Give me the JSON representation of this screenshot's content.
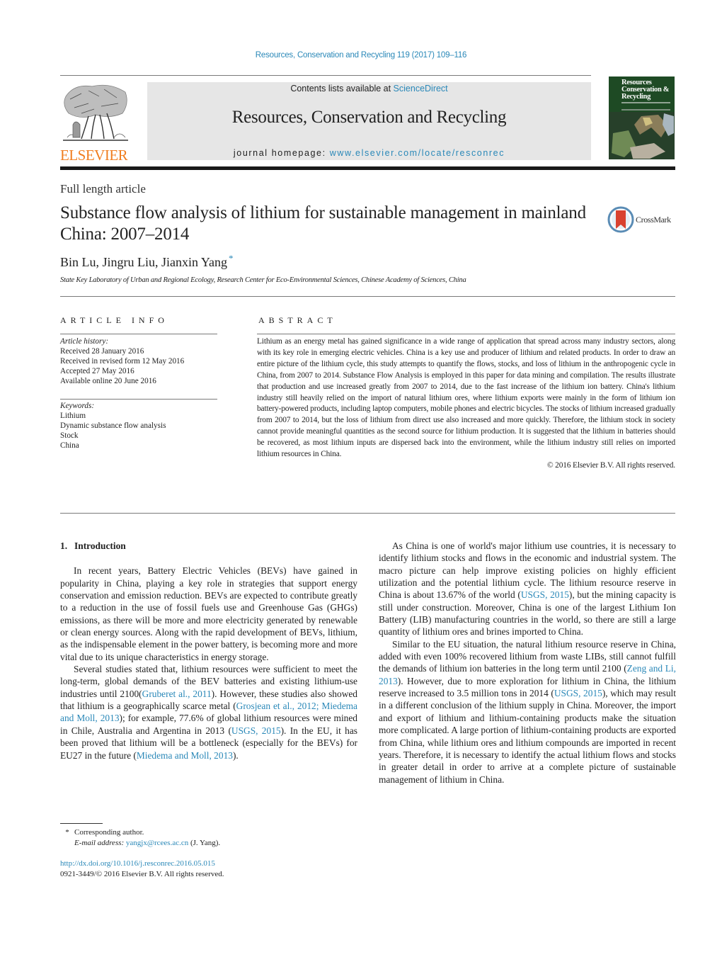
{
  "header": {
    "journal_reference": "Resources, Conservation and Recycling 119 (2017) 109–116",
    "contents_prefix": "Contents lists available at ",
    "contents_link": "ScienceDirect",
    "journal_title": "Resources, Conservation and Recycling",
    "homepage_prefix": "journal homepage: ",
    "homepage_link": "www.elsevier.com/locate/resconrec",
    "publisher_logo_text": "ELSEVIER",
    "cover_title": "Resources Conservation & Recycling",
    "crossmark_label": "CrossMark"
  },
  "article": {
    "type": "Full length article",
    "title": "Substance flow analysis of lithium for sustainable management in mainland China: 2007–2014",
    "authors": "Bin Lu, Jingru Liu, Jianxin Yang",
    "corresponding_marker": "*",
    "affiliation": "State Key Laboratory of Urban and Regional Ecology, Research Center for Eco-Environmental Sciences, Chinese Academy of Sciences, China"
  },
  "article_info": {
    "heading": "ARTICLE INFO",
    "history_label": "Article history:",
    "history": [
      "Received 28 January 2016",
      "Received in revised form 12 May 2016",
      "Accepted 27 May 2016",
      "Available online 20 June 2016"
    ],
    "keywords_label": "Keywords:",
    "keywords": [
      "Lithium",
      "Dynamic substance flow analysis",
      "Stock",
      "China"
    ]
  },
  "abstract": {
    "heading": "ABSTRACT",
    "text": "Lithium as an energy metal has gained significance in a wide range of application that spread across many industry sectors, along with its key role in emerging electric vehicles. China is a key use and producer of lithium and related products. In order to draw an entire picture of the lithium cycle, this study attempts to quantify the flows, stocks, and loss of lithium in the anthropogenic cycle in China, from 2007 to 2014. Substance Flow Analysis is employed in this paper for data mining and compilation. The results illustrate that production and use increased greatly from 2007 to 2014, due to the fast increase of the lithium ion battery. China's lithium industry still heavily relied on the import of natural lithium ores, where lithium exports were mainly in the form of lithium ion battery-powered products, including laptop computers, mobile phones and electric bicycles. The stocks of lithium increased gradually from 2007 to 2014, but the loss of lithium from direct use also increased and more quickly. Therefore, the lithium stock in society cannot provide meaningful quantities as the second source for lithium production. It is suggested that the lithium in batteries should be recovered, as most lithium inputs are dispersed back into the environment, while the lithium industry still relies on imported lithium resources in China.",
    "copyright": "© 2016 Elsevier B.V. All rights reserved."
  },
  "body": {
    "section_number": "1.",
    "section_title": "Introduction",
    "left_paragraphs": [
      {
        "segments": [
          {
            "text": "In recent years, Battery Electric Vehicles (BEVs) have gained in popularity in China, playing a key role in strategies that support energy conservation and emission reduction. BEVs are expected to contribute greatly to a reduction in the use of fossil fuels use and Greenhouse Gas (GHGs) emissions, as there will be more and more electricity generated by renewable or clean energy sources. Along with the rapid development of BEVs, lithium, as the indispensable element in the power battery, is becoming more and more vital due to its unique characteristics in energy storage."
          }
        ]
      },
      {
        "segments": [
          {
            "text": "Several studies stated that, lithium resources were sufficient to meet the long-term, global demands of the BEV batteries and existing lithium-use industries until 2100("
          },
          {
            "text": "Gruberet al., 2011",
            "link": true
          },
          {
            "text": "). However, these studies also showed that lithium is a geographically scarce metal ("
          },
          {
            "text": "Grosjean et al., 2012; Miedema and Moll, 2013",
            "link": true
          },
          {
            "text": "); for example, 77.6% of global lithium resources were mined in Chile, Australia and Argentina in 2013 ("
          },
          {
            "text": "USGS, 2015",
            "link": true
          },
          {
            "text": "). In the EU, it has been proved that lithium will be a bottleneck (especially for the BEVs) for EU27 in the future ("
          },
          {
            "text": "Miedema and Moll, 2013",
            "link": true
          },
          {
            "text": ")."
          }
        ]
      }
    ],
    "right_paragraphs": [
      {
        "segments": [
          {
            "text": "As China is one of world's major lithium use countries, it is necessary to identify lithium stocks and flows in the economic and industrial system. The macro picture can help improve existing policies on highly efficient utilization and the potential lithium cycle. The lithium resource reserve in China is about 13.67% of the world ("
          },
          {
            "text": "USGS, 2015",
            "link": true
          },
          {
            "text": "), but the mining capacity is still under construction. Moreover, China is one of the largest Lithium Ion Battery (LIB) manufacturing countries in the world, so there are still a large quantity of lithium ores and brines imported to China."
          }
        ]
      },
      {
        "segments": [
          {
            "text": "Similar to the EU situation, the natural lithium resource reserve in China, added with even 100% recovered lithium from waste LIBs, still cannot fulfill the demands of lithium ion batteries in the long term until 2100 ("
          },
          {
            "text": "Zeng and Li, 2013",
            "link": true
          },
          {
            "text": "). However, due to more exploration for lithium in China, the lithium reserve increased to 3.5 million tons in 2014 ("
          },
          {
            "text": "USGS, 2015",
            "link": true
          },
          {
            "text": "), which may result in a different conclusion of the lithium supply in China. Moreover, the import and export of lithium and lithium-containing products make the situation more complicated. A large portion of lithium-containing products are exported from China, while lithium ores and lithium compounds are imported in recent years. Therefore, it is necessary to identify the actual lithium flows and stocks in greater detail in order to arrive at a complete picture of sustainable management of lithium in China."
          }
        ]
      }
    ]
  },
  "footnote": {
    "marker": "*",
    "text": "Corresponding author.",
    "email_label": "E-mail address:",
    "email": "yangjx@rcees.ac.cn",
    "email_suffix": " (J. Yang)."
  },
  "doi": {
    "link": "http://dx.doi.org/10.1016/j.resconrec.2016.05.015",
    "issn_line": "0921-3449/© 2016 Elsevier B.V. All rights reserved."
  },
  "colors": {
    "link": "#2a88b8",
    "elsevier_orange": "#f07d1f",
    "masthead_gray": "#e6e6e6"
  }
}
